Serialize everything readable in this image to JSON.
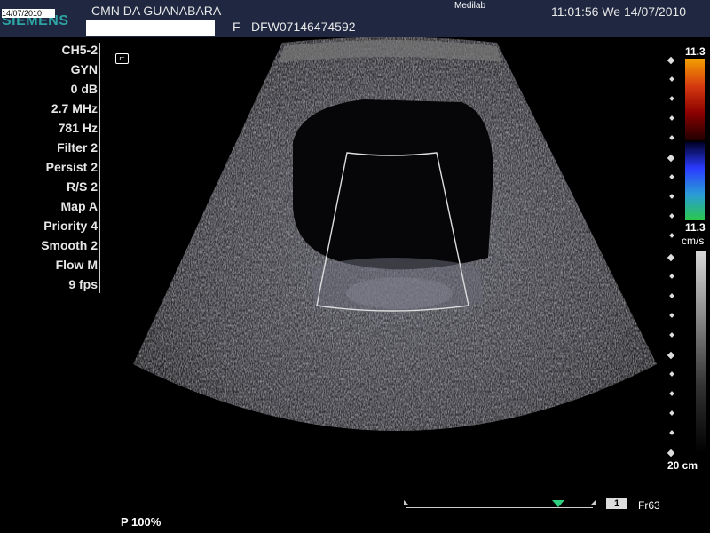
{
  "header": {
    "logo": "SIEMENS",
    "logo_date": "14/07/2010",
    "clinic": "CMN DA GUANABARA",
    "patient_sex": "F",
    "patient_id": "DFW07146474592",
    "institution": "Medilab",
    "datetime": "11:01:56  We  14/07/2010"
  },
  "params": [
    "CH5-2",
    "GYN",
    "0 dB",
    "2.7 MHz",
    "781 Hz",
    "Filter 2",
    "Persist 2",
    "R/S 2",
    "Map A",
    "Priority 4",
    "Smooth 2",
    "Flow M",
    "9 fps"
  ],
  "colorbar": {
    "top_label": "11.3",
    "bottom_label": "11.3",
    "unit": "cm/s",
    "colors": [
      "#f5a000",
      "#8a0000",
      "#2a3bff",
      "#2bc84b"
    ]
  },
  "depth": {
    "label": "20 cm"
  },
  "power": "P 100%",
  "cine": {
    "frame_badge": "1",
    "frame_label": "Fr63"
  },
  "icons": {
    "trace": "fl-icon"
  }
}
